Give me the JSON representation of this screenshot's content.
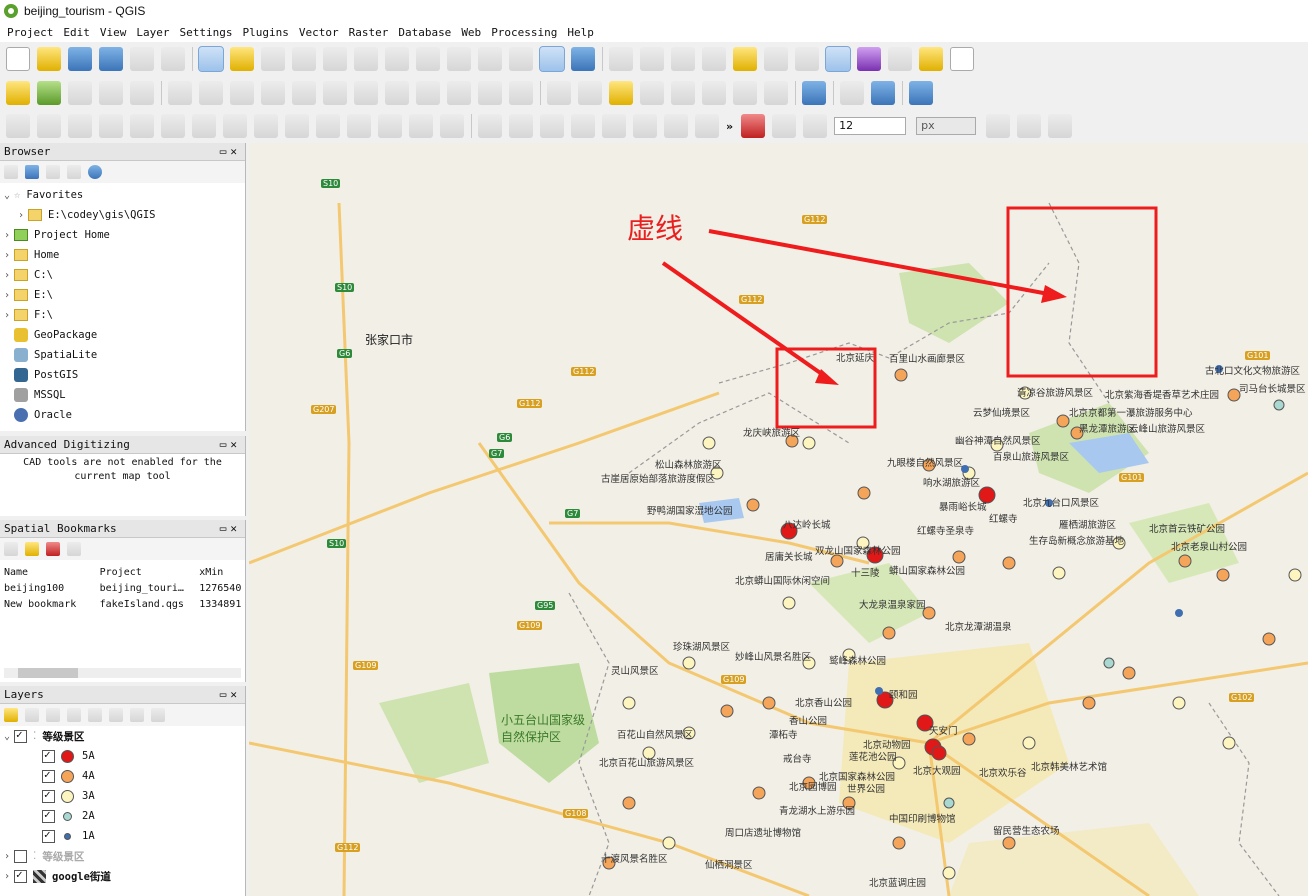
{
  "window": {
    "title": "beijing_tourism - QGIS"
  },
  "menu": [
    "Project",
    "Edit",
    "View",
    "Layer",
    "Settings",
    "Plugins",
    "Vector",
    "Raster",
    "Database",
    "Web",
    "Processing",
    "Help"
  ],
  "toolbar": {
    "snap_tolerance": "12",
    "snap_unit": "px",
    "overflow": "»"
  },
  "browser": {
    "title": "Browser",
    "items": [
      {
        "label": "Favorites",
        "icon": "star-icon"
      },
      {
        "label": "E:\\codey\\gis\\QGIS",
        "icon": "folder-icon"
      },
      {
        "label": "Project Home",
        "icon": "project-home-icon"
      },
      {
        "label": "Home",
        "icon": "folder-icon"
      },
      {
        "label": "C:\\",
        "icon": "folder-icon"
      },
      {
        "label": "E:\\",
        "icon": "folder-icon"
      },
      {
        "label": "F:\\",
        "icon": "folder-icon"
      },
      {
        "label": "GeoPackage",
        "icon": "geopackage-icon"
      },
      {
        "label": "SpatiaLite",
        "icon": "spatialite-icon"
      },
      {
        "label": "PostGIS",
        "icon": "postgis-icon"
      },
      {
        "label": "MSSQL",
        "icon": "mssql-icon"
      },
      {
        "label": "Oracle",
        "icon": "oracle-icon"
      }
    ]
  },
  "advanced_digitizing": {
    "title": "Advanced Digitizing",
    "message": "CAD tools are not enabled for the current map tool"
  },
  "bookmarks": {
    "title": "Spatial Bookmarks",
    "headers": [
      "Name",
      "Project",
      "xMin"
    ],
    "rows": [
      [
        "beijing100",
        "beijing_touri…",
        "1276540"
      ],
      [
        "New bookmark",
        "fakeIsland.qgs",
        "1334891"
      ]
    ]
  },
  "layers": {
    "title": "Layers",
    "group": "等级景区",
    "classes": [
      {
        "label": "5A",
        "color": "#e01818"
      },
      {
        "label": "4A",
        "color": "#f5a55a"
      },
      {
        "label": "3A",
        "color": "#fdf5c0"
      },
      {
        "label": "2A",
        "color": "#a8d8d0"
      },
      {
        "label": "1A",
        "color": "#3f6fb0"
      }
    ],
    "inactive": "等级景区",
    "basemap": "google街道"
  },
  "map": {
    "annotation": "虚线",
    "city": "张家口市",
    "labels": [
      "北京延庆",
      "百里山水画廊景区",
      "清凉谷旅游风景区",
      "北京紫海香堤香草艺术庄园",
      "古北口文化文物旅游区",
      "司马台长城景区",
      "云梦仙境景区",
      "北京京都第一瀑旅游服务中心",
      "幽谷神潭自然风景区",
      "黑龙潭旅游区",
      "云峰山旅游风景区",
      "九眼楼自然风景区",
      "百泉山旅游风景区",
      "响水湖旅游区",
      "北京九台口风景区",
      "暴雨峪长城",
      "红螺寺",
      "雁栖湖旅游区",
      "红螺寺圣泉寺",
      "生存岛新概念旅游基地",
      "北京首云铁矿公园",
      "北京老泉山村公园",
      "龙庆峡旅游区",
      "松山森林旅游区",
      "古崖居原始部落旅游度假区",
      "野鸭湖国家湿地公园",
      "八达岭长城",
      "居庸关长城",
      "十三陵",
      "双龙山国家森林公园",
      "北京蟒山国际休闲空间",
      "蟒山国家森林公园",
      "大龙泉温泉家园",
      "北京龙潭湖温泉",
      "鹫峰森林公园",
      "北京香山公园",
      "香山公园",
      "颐和园",
      "北京动物园",
      "天安门",
      "北京欢乐谷",
      "世界公园",
      "北京园博园",
      "青龙湖水上游乐园",
      "中国印刷博物馆",
      "留民营生态农场",
      "北京韩美林艺术馆",
      "小五台山国家级自然保护区",
      "灵山风景区",
      "百花山自然风景区",
      "北京百花山旅游风景区",
      "珍珠湖风景区",
      "妙峰山风景名胜区",
      "戒台寺",
      "潭柘寺",
      "北京国家森林公园",
      "莲花池公园",
      "北京大观园",
      "周口店遗址博物馆",
      "仙栖洞景区",
      "十渡风景名胜区",
      "北京蓝调庄园"
    ]
  }
}
